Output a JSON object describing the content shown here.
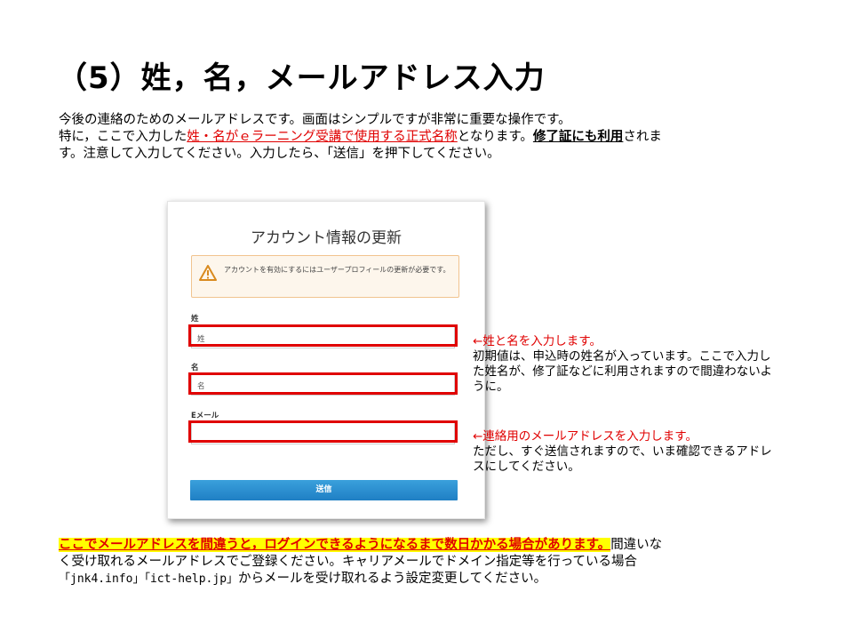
{
  "title": "（5）姓，名，メールアドレス入力",
  "intro": {
    "line1": "今後の連絡のためのメールアドレスです。画面はシンプルですが非常に重要な操作です。",
    "line2_pre": "特に，ここで入力した",
    "line2_red": "姓・名がｅラーニング受講で使用する正式名称",
    "line2_mid": "となります。",
    "line2_bold": "修了証にも利用",
    "line2_post": "されま",
    "line3": "す。注意して入力してください。入力したら、「送信」を押下してください。"
  },
  "form": {
    "title": "アカウント情報の更新",
    "warning": "アカウントを有効にするにはユーザープロフィールの更新が必要です。",
    "last_name_label": "姓",
    "last_name_placeholder": "姓",
    "first_name_label": "名",
    "first_name_placeholder": "名",
    "email_label": "Eメール",
    "email_value": "",
    "submit_label": "送信"
  },
  "notes": {
    "name_heading": "←姓と名を入力します。",
    "name_line1": "初期値は、申込時の姓名が入っています。ここで入力し",
    "name_line2": "た姓名が、修了証などに利用されますので間違わないよ",
    "name_line3": "うに。",
    "email_heading": "←連絡用のメールアドレスを入力します。",
    "email_line1": "ただし、すぐ送信されますので、いま確認できるアドレ",
    "email_line2": "スにしてください。"
  },
  "bottom": {
    "highlight": "ここでメールアドレスを間違うと，ログインできるようになるまで数日かかる場合があります。",
    "line1_rest": "間違いな",
    "line2": "く受け取れるメールアドレスでご登録ください。キャリアメールでドメイン指定等を行っている場合",
    "line3_a": "「jnk4.info」「ict-help.jp」",
    "line3_b": "からメールを受け取れるよう設定変更してください。"
  },
  "colors": {
    "accent_red": "#e00000",
    "highlight_yellow": "#ffff00",
    "button_blue": "#1f7fc4",
    "warning_border": "#f1c48f"
  }
}
